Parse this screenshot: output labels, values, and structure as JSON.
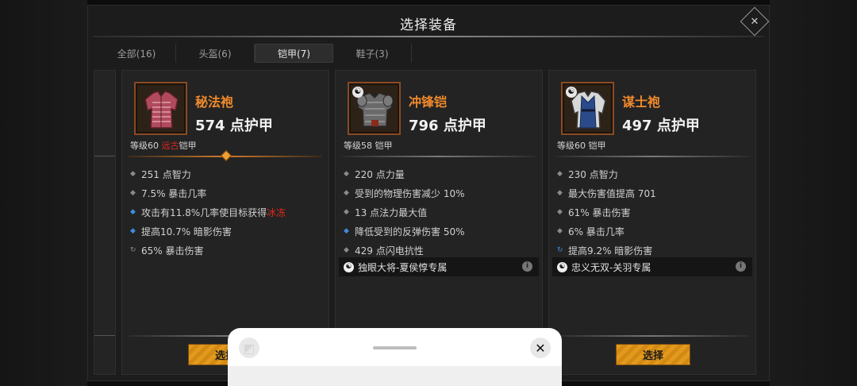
{
  "dialog": {
    "title": "选择装备",
    "close_icon": "close-icon"
  },
  "tabs": [
    {
      "label": "全部(16)",
      "active": false
    },
    {
      "label": "头盔(6)",
      "active": false
    },
    {
      "label": "铠甲(7)",
      "active": true
    },
    {
      "label": "鞋子(3)",
      "active": false
    }
  ],
  "cards": [
    {
      "name": "秘法袍",
      "armor": "574 点护甲",
      "level_prefix": "等级60 ",
      "level_tag": "远古",
      "level_suffix": "铠甲",
      "stats": [
        {
          "bullet": "◆",
          "text": "251 点智力"
        },
        {
          "bullet": "◆",
          "text": "7.5% 暴击几率"
        },
        {
          "bullet": "◆",
          "text": "攻击有11.8%几率使目标获得",
          "highlight": "冰冻"
        },
        {
          "bullet": "◆",
          "text": "提高10.7% 暗影伤害"
        },
        {
          "bullet": "↻",
          "text": "65% 暴击伤害"
        }
      ],
      "button": "选择"
    },
    {
      "name": "冲锋铠",
      "armor": "796 点护甲",
      "level": "等级58 铠甲",
      "stats": [
        {
          "bullet": "◆",
          "text": "220 点力量"
        },
        {
          "bullet": "◆",
          "text": "受到的物理伤害减少 10%"
        },
        {
          "bullet": "◆",
          "text": "13 点法力最大值"
        },
        {
          "bullet": "◆",
          "text": "降低受到的反弹伤害 50%"
        },
        {
          "bullet": "◆",
          "text": "429 点闪电抗性"
        }
      ],
      "set": "独眼大将-夏侯惇专属",
      "info_icon": "i"
    },
    {
      "name": "谋士袍",
      "armor": "497 点护甲",
      "level": "等级60 铠甲",
      "stats": [
        {
          "bullet": "◆",
          "text": "230 点智力"
        },
        {
          "bullet": "◆",
          "text": "最大伤害值提高 701"
        },
        {
          "bullet": "◆",
          "text": "61% 暴击伤害"
        },
        {
          "bullet": "◆",
          "text": "6% 暴击几率"
        },
        {
          "bullet": "↻",
          "text": "提高9.2% 暗影伤害"
        }
      ],
      "set": "忠义无双-关羽专属",
      "info_icon": "i",
      "button": "选择"
    }
  ],
  "sheet": {
    "close_glyph": "✕",
    "left_glyph": "◩"
  },
  "colors": {
    "accent_orange": "#f08a2c",
    "button": "#e39a1c",
    "legendary_red": "#e02a1c",
    "blue_affix": "#3d8ce0"
  }
}
